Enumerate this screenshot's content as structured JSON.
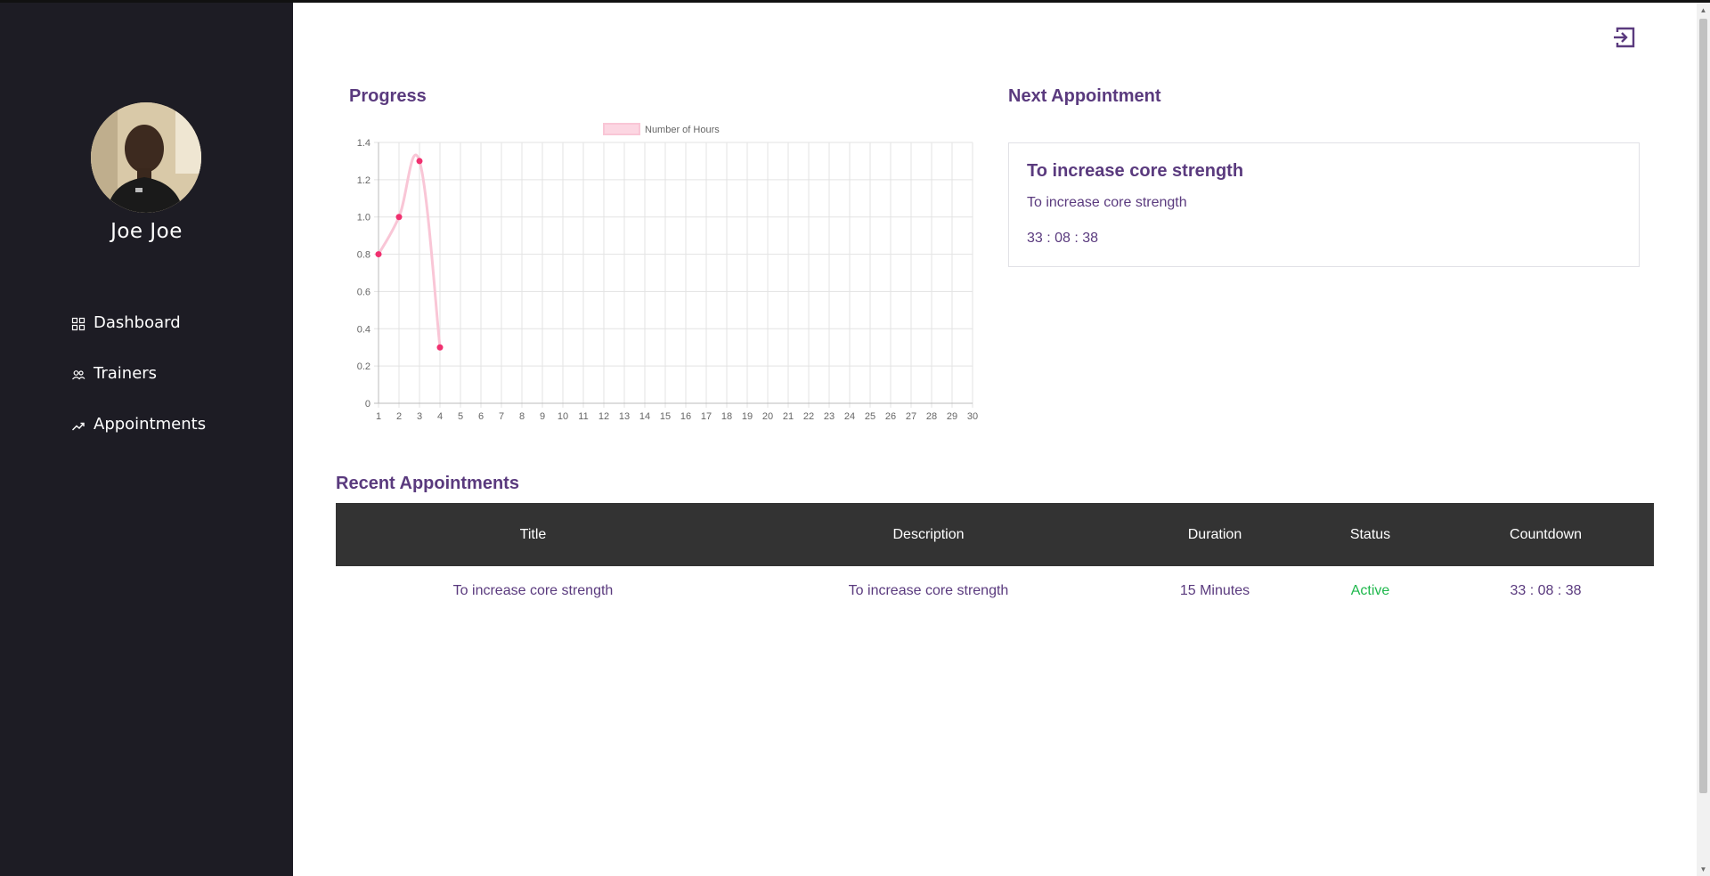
{
  "user": {
    "name": "Joe Joe"
  },
  "nav": [
    {
      "label": "Dashboard",
      "icon": "grid-icon"
    },
    {
      "label": "Trainers",
      "icon": "users-icon"
    },
    {
      "label": "Appointments",
      "icon": "trending-icon"
    }
  ],
  "progress": {
    "title": "Progress"
  },
  "chart_data": {
    "type": "line",
    "title": "",
    "xlabel": "",
    "ylabel": "",
    "x": [
      1,
      2,
      3,
      4,
      5,
      6,
      7,
      8,
      9,
      10,
      11,
      12,
      13,
      14,
      15,
      16,
      17,
      18,
      19,
      20,
      21,
      22,
      23,
      24,
      25,
      26,
      27,
      28,
      29,
      30
    ],
    "series": [
      {
        "name": "Number of Hours",
        "x": [
          1,
          2,
          3,
          4
        ],
        "values": [
          0.8,
          1.0,
          1.3,
          0.3
        ]
      }
    ],
    "ylim": [
      0,
      1.4
    ],
    "yticks": [
      "0",
      "0.2",
      "0.4",
      "0.6",
      "0.8",
      "1.0",
      "1.2",
      "1.4"
    ],
    "grid": true,
    "legend": "top-center",
    "colors": {
      "line": "#f9c6d6",
      "point": "#f0306f",
      "legend_fill": "#fcd6e2"
    }
  },
  "next_appointment": {
    "heading": "Next Appointment",
    "title": "To increase core strength",
    "description": "To increase core strength",
    "countdown": "33 : 08 : 38"
  },
  "recent": {
    "heading": "Recent Appointments",
    "columns": [
      "Title",
      "Description",
      "Duration",
      "Status",
      "Countdown"
    ],
    "rows": [
      {
        "title": "To increase core strength",
        "description": "To increase core strength",
        "duration": "15 Minutes",
        "status": "Active",
        "countdown": "33 : 08 : 38"
      }
    ]
  },
  "theme": {
    "sidebar_bg": "#1d1c24",
    "accent": "#5a3a7e",
    "header_bg": "#333333",
    "status_active": "#1fb84d"
  }
}
